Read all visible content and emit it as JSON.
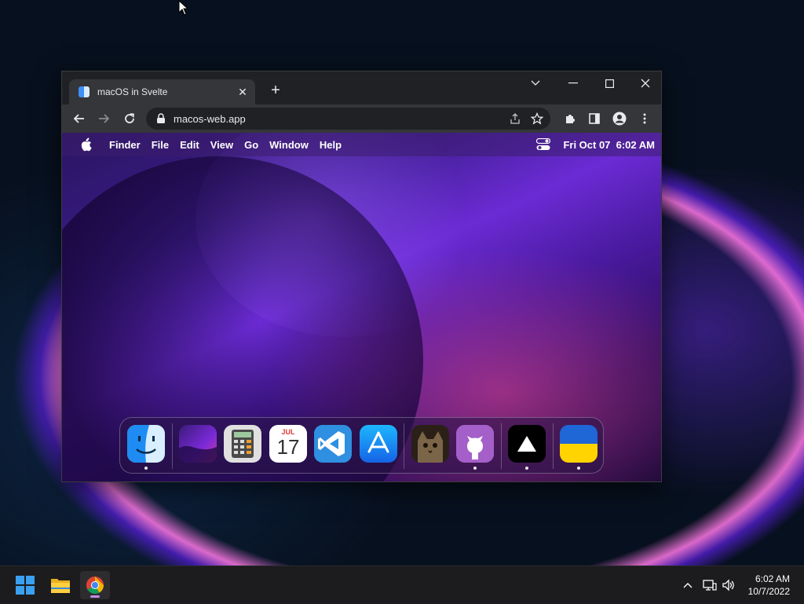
{
  "browser": {
    "tab_title": "macOS in Svelte",
    "tab_close": "✕",
    "new_tab": "+",
    "url": "macos-web.app"
  },
  "macos": {
    "menu": [
      "Finder",
      "File",
      "Edit",
      "View",
      "Go",
      "Window",
      "Help"
    ],
    "datetime": "Fri Oct 07  6:02 AM",
    "calendar_month": "JUL",
    "calendar_day": "17"
  },
  "taskbar": {
    "time": "6:02 AM",
    "date": "10/7/2022"
  },
  "colors": {
    "accent": "#c68ae6",
    "chrome_dark": "#202124",
    "chrome_toolbar": "#35363a"
  }
}
